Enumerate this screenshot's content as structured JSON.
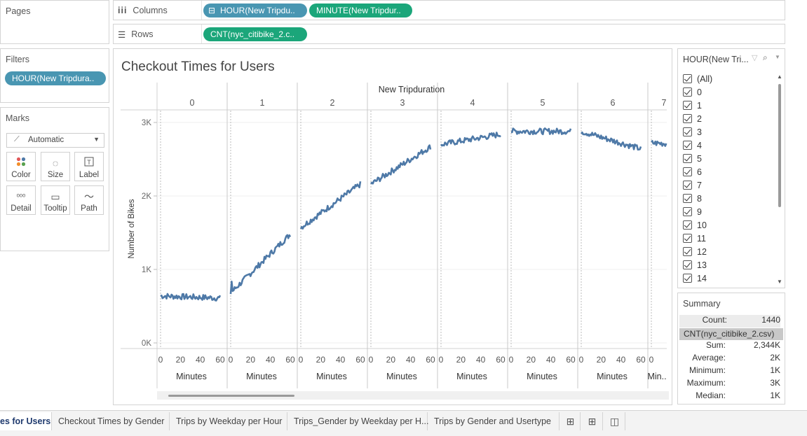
{
  "pages_panel": {
    "title": "Pages"
  },
  "filters_panel": {
    "title": "Filters",
    "pill": "HOUR(New Tripdura.."
  },
  "marks_panel": {
    "title": "Marks",
    "mark_type": "Automatic",
    "buttons": [
      "Color",
      "Size",
      "Label",
      "Detail",
      "Tooltip",
      "Path"
    ]
  },
  "shelves": {
    "columns_label": "Columns",
    "columns_pills": [
      "HOUR(New Tripdu..",
      "MINUTE(New Tripdur.."
    ],
    "rows_label": "Rows",
    "rows_pills": [
      "CNT(nyc_citibike_2.c.."
    ]
  },
  "chart_title": "Checkout Times for Users",
  "filter_card": {
    "title": "HOUR(New Tri...",
    "items": [
      "(All)",
      "0",
      "1",
      "2",
      "3",
      "4",
      "5",
      "6",
      "7",
      "8",
      "9",
      "10",
      "11",
      "12",
      "13",
      "14"
    ]
  },
  "summary": {
    "title": "Summary",
    "count_label": "Count:",
    "count": "1440",
    "field": "CNT(nyc_citibike_2.csv)",
    "rows": [
      {
        "k": "Sum:",
        "v": "2,344K"
      },
      {
        "k": "Average:",
        "v": "2K"
      },
      {
        "k": "Minimum:",
        "v": "1K"
      },
      {
        "k": "Maximum:",
        "v": "3K"
      },
      {
        "k": "Median:",
        "v": "1K"
      }
    ]
  },
  "tabs": [
    "es for Users",
    "Checkout Times by Gender",
    "Trips by Weekday per Hour",
    "Trips_Gender by Weekday per H...",
    "Trips by Gender and Usertype"
  ],
  "chart_data": {
    "type": "line",
    "title": "Checkout Times for Users",
    "header": "New Tripduration",
    "ylabel": "Number of Bikes",
    "y_ticks": [
      "0K",
      "1K",
      "2K",
      "3K"
    ],
    "ylim": [
      0,
      3000
    ],
    "panes": [
      "0",
      "1",
      "2",
      "3",
      "4",
      "5",
      "6",
      "7"
    ],
    "x_ticks": [
      "0",
      "20",
      "40",
      "60"
    ],
    "x_label": "Minutes",
    "x_label_last": "Min..",
    "series": [
      {
        "hour": 0,
        "start": 640,
        "end": 610
      },
      {
        "hour": 1,
        "start": 680,
        "end": 1480
      },
      {
        "hour": 2,
        "start": 1570,
        "end": 2160
      },
      {
        "hour": 3,
        "start": 2160,
        "end": 2670
      },
      {
        "hour": 4,
        "start": 2700,
        "end": 2840
      },
      {
        "hour": 5,
        "start": 2880,
        "end": 2880
      },
      {
        "hour": 6,
        "start": 2880,
        "end": 2640
      },
      {
        "hour": 7,
        "start": 2720,
        "end": 2690
      }
    ]
  }
}
